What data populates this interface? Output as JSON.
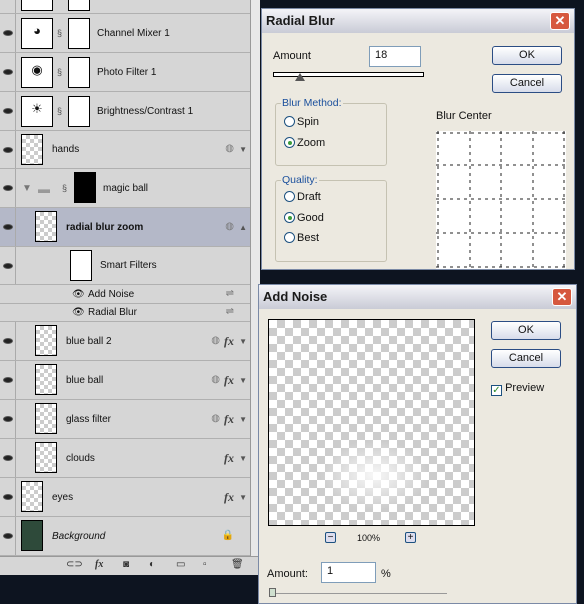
{
  "layers": {
    "rows": [
      {
        "name": "Channel Mixer 1",
        "kind": "adjustment",
        "icon": "channel-mixer-icon"
      },
      {
        "name": "Photo Filter 1",
        "kind": "adjustment",
        "icon": "photo-filter-icon"
      },
      {
        "name": "Brightness/Contrast 1",
        "kind": "adjustment",
        "icon": "brightness-contrast-icon"
      },
      {
        "name": "hands",
        "kind": "smart"
      },
      {
        "name": "magic ball",
        "kind": "group"
      },
      {
        "name": "radial blur zoom",
        "kind": "smart",
        "selected": true
      },
      {
        "name": "Smart Filters",
        "kind": "smartfilters"
      },
      {
        "name": "Add Noise",
        "kind": "filter"
      },
      {
        "name": "Radial Blur",
        "kind": "filter"
      },
      {
        "name": "blue ball 2",
        "kind": "smart",
        "fx": "fx"
      },
      {
        "name": "blue ball",
        "kind": "smart",
        "fx": "fx"
      },
      {
        "name": "glass filter",
        "kind": "smart",
        "fx": "fx"
      },
      {
        "name": "clouds",
        "kind": "smart",
        "fx": "fx"
      },
      {
        "name": "eyes",
        "kind": "normal",
        "fx": "fx"
      },
      {
        "name": "Background",
        "kind": "background"
      }
    ],
    "toolbar": {
      "link": "link-icon",
      "fx": "fx",
      "mask": "mask-icon",
      "adjust": "adjustment-icon",
      "group": "folder-icon",
      "new": "new-layer-icon",
      "trash": "trash-icon"
    }
  },
  "radial_blur": {
    "title": "Radial Blur",
    "close": "✕",
    "amount_label": "Amount",
    "amount": "18",
    "amount_max": 100,
    "ok": "OK",
    "cancel": "Cancel",
    "blur_method_label": "Blur Method:",
    "methods": [
      "Spin",
      "Zoom"
    ],
    "method_selected": "Zoom",
    "quality_label": "Quality:",
    "qualities": [
      "Draft",
      "Good",
      "Best"
    ],
    "quality_selected": "Good",
    "blur_center_label": "Blur Center"
  },
  "add_noise": {
    "title": "Add Noise",
    "close": "✕",
    "ok": "OK",
    "cancel": "Cancel",
    "preview_label": "Preview",
    "preview_checked": true,
    "zoom": "100%",
    "zoom_out": "−",
    "zoom_in": "+",
    "amount_label": "Amount:",
    "amount": "1",
    "unit": "%"
  }
}
